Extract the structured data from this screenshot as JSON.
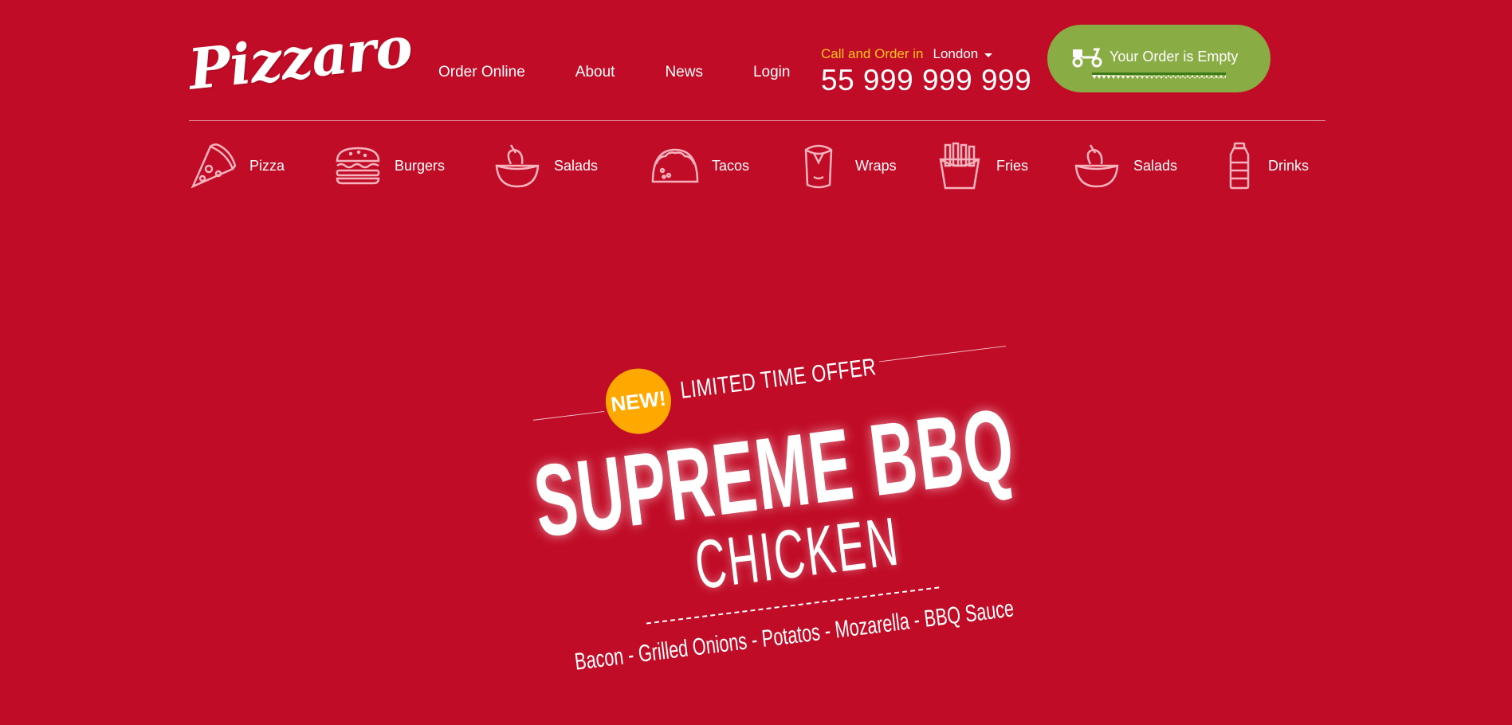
{
  "brand": {
    "logo_text": "Pizzaro"
  },
  "nav": [
    "Order Online",
    "About",
    "News",
    "Login"
  ],
  "contact": {
    "call_label": "Call and Order in",
    "city": "London",
    "phone": "55 999 999 999"
  },
  "cart": {
    "label": "Your Order is Empty",
    "icon": "scooter-icon"
  },
  "categories": [
    {
      "label": "Pizza",
      "icon": "pizza-slice-icon"
    },
    {
      "label": "Burgers",
      "icon": "burger-icon"
    },
    {
      "label": "Salads",
      "icon": "salad-bowl-icon"
    },
    {
      "label": "Tacos",
      "icon": "taco-icon"
    },
    {
      "label": "Wraps",
      "icon": "wrap-icon"
    },
    {
      "label": "Fries",
      "icon": "fries-icon"
    },
    {
      "label": "Salads",
      "icon": "salad-bowl-icon"
    },
    {
      "label": "Drinks",
      "icon": "bottle-icon"
    }
  ],
  "hero": {
    "badge": "NEW!",
    "tagline": "LIMITED TIME OFFER",
    "title": "SUPREME BBQ",
    "subtitle": "CHICKEN",
    "ingredients": "Bacon  -  Grilled Onions  -  Potatos  -  Mozarella  -  BBQ Sauce"
  },
  "colors": {
    "background": "#c10c27",
    "accent_yellow": "#ffc21a",
    "badge": "#ffa800",
    "cart_green": "#8aac45"
  }
}
